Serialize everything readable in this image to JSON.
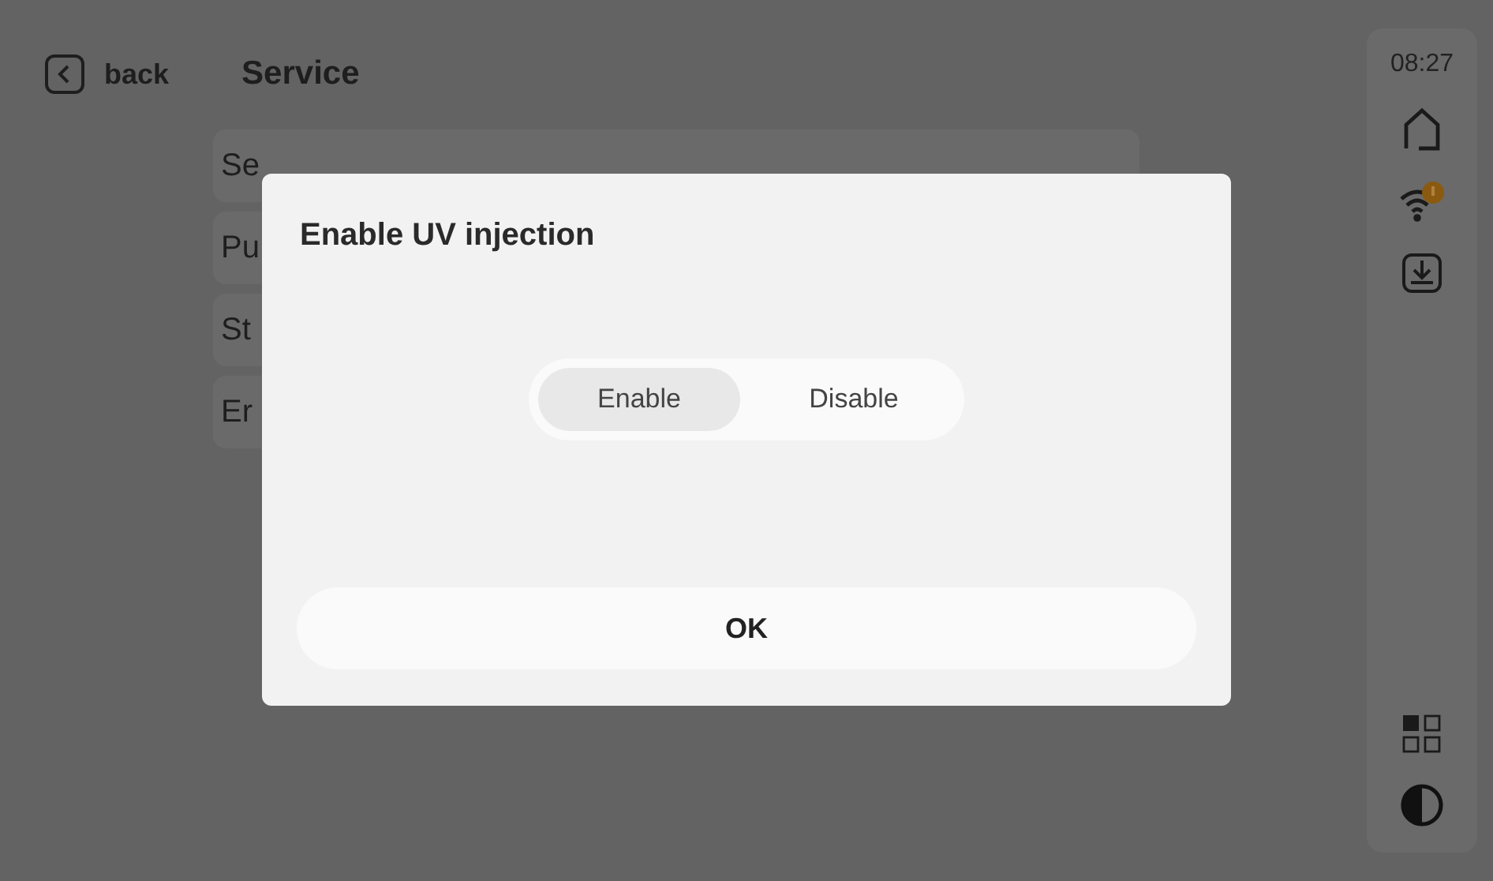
{
  "header": {
    "back_label": "back",
    "title": "Service"
  },
  "menu_items": [
    {
      "label": "Se"
    },
    {
      "label": "Pu"
    },
    {
      "label": "St"
    },
    {
      "label": "Er"
    }
  ],
  "sidebar": {
    "time": "08:27",
    "wifi_alert": true
  },
  "dialog": {
    "title": "Enable UV injection",
    "options": [
      {
        "label": "Enable",
        "selected": true
      },
      {
        "label": "Disable",
        "selected": false
      }
    ],
    "ok_label": "OK"
  }
}
